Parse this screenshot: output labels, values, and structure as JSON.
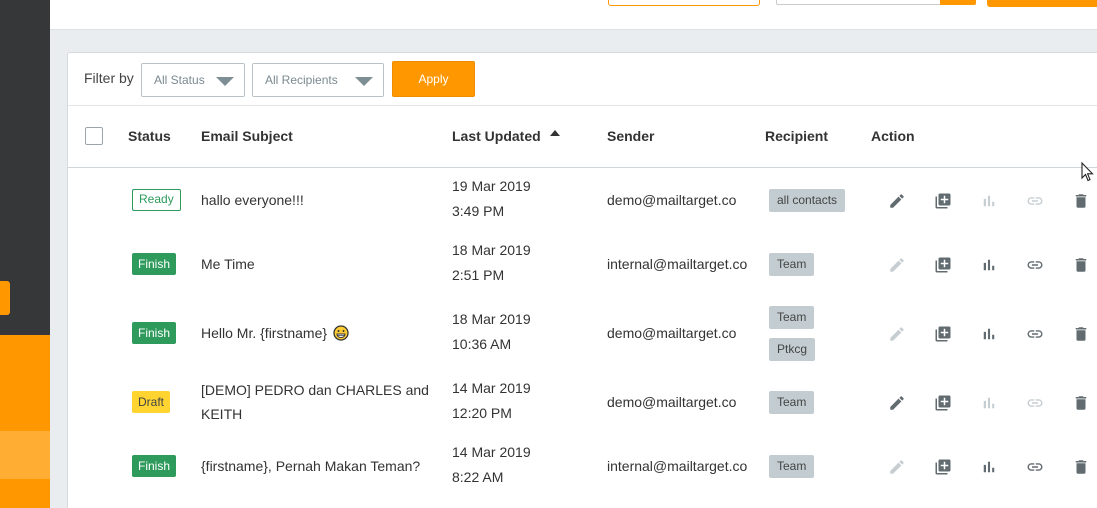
{
  "filter": {
    "label": "Filter by",
    "status_select": "All Status",
    "recipient_select": "All Recipients",
    "apply_label": "Apply"
  },
  "table": {
    "headers": {
      "status": "Status",
      "subject": "Email Subject",
      "last_updated": "Last Updated",
      "sender": "Sender",
      "recipient": "Recipient",
      "action": "Action"
    },
    "rows": [
      {
        "status": "Ready",
        "subject": "hallo everyone!!!",
        "date": "19 Mar 2019",
        "time": "3:49 PM",
        "sender": "demo@mailtarget.co",
        "recipients": [
          "all contacts"
        ]
      },
      {
        "status": "Finish",
        "subject": "Me Time",
        "date": "18 Mar 2019",
        "time": "2:51 PM",
        "sender": "internal@mailtarget.co",
        "recipients": [
          "Team"
        ]
      },
      {
        "status": "Finish",
        "subject": "Hello Mr. {firstname}",
        "date": "18 Mar 2019",
        "time": "10:36 AM",
        "sender": "demo@mailtarget.co",
        "recipients": [
          "Team",
          "Ptkcg"
        ]
      },
      {
        "status": "Draft",
        "subject": "[DEMO] PEDRO dan CHARLES and KEITH",
        "date": "14 Mar 2019",
        "time": "12:20 PM",
        "sender": "demo@mailtarget.co",
        "recipients": [
          "Team"
        ]
      },
      {
        "status": "Finish",
        "subject": "{firstname}, Pernah Makan Teman?",
        "date": "14 Mar 2019",
        "time": "8:22 AM",
        "sender": "internal@mailtarget.co",
        "recipients": [
          "Team"
        ]
      }
    ]
  },
  "icons": {
    "edit": "pencil-icon",
    "duplicate": "duplicate-icon",
    "report": "bar-chart-icon",
    "link": "link-icon",
    "delete": "trash-icon",
    "emoji": "grinning-face-icon"
  },
  "colors": {
    "accent": "#ff9800",
    "success": "#2e9a5c",
    "draft": "#ffd430",
    "tag": "#c3cdd1",
    "sidebar": "#363738",
    "icon_active": "#616b70",
    "icon_disabled": "#c7ced2"
  }
}
